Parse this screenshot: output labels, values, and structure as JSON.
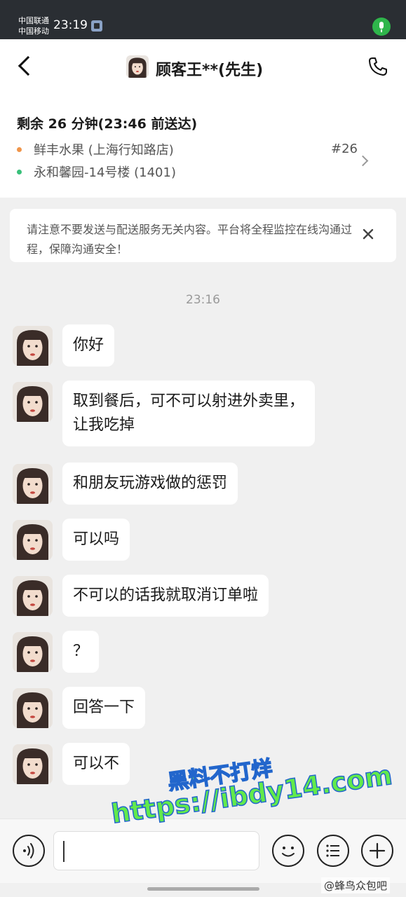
{
  "status_bar": {
    "carrier_1": "中国联通",
    "carrier_2": "中国移动",
    "time": "23:19"
  },
  "header": {
    "back_icon": "chevron-left-icon",
    "title": "顾客王**(先生)",
    "call_icon": "phone-icon"
  },
  "order": {
    "remaining": "剩余 26 分钟(23:46 前送达)",
    "store": "鲜丰水果 (上海行知路店)",
    "order_number": "#26",
    "address": "永和馨园-14号楼 (1401)",
    "store_dot_color": "#f0954a",
    "address_dot_color": "#39c07a"
  },
  "notice": {
    "text": "请注意不要发送与配送服务无关内容。平台将全程监控在线沟通过程，保障沟通安全！"
  },
  "chat": {
    "timestamp": "23:16",
    "messages": [
      "你好",
      "取到餐后，可不可以射进外卖里，\n让我吃掉",
      "和朋友玩游戏做的惩罚",
      "可以吗",
      "不可以的话我就取消订单啦",
      "？",
      "回答一下",
      "可以不"
    ]
  },
  "input_bar": {
    "placeholder": "",
    "voice_icon": "voice-icon",
    "emoji_icon": "emoji-icon",
    "menu_icon": "list-icon",
    "add_icon": "plus-icon"
  },
  "overlays": {
    "watermark_line1": "黑料不打烊",
    "watermark_line2": "https://ibdy14.com",
    "source_tag": "@蜂鸟众包吧"
  }
}
